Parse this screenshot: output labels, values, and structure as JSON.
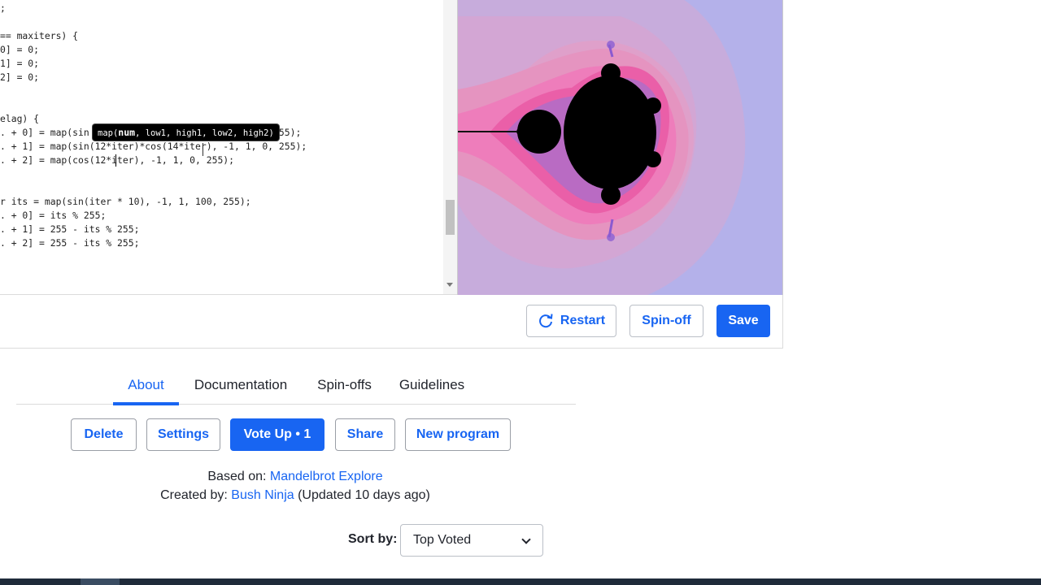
{
  "editor": {
    "lines": [
      ";",
      "== maxiters) {",
      "0] = 0;",
      "1] = 0;",
      "2] = 0;",
      "elag) {",
      ". + 0] = map(sin                              0, 255);",
      ". + 1] = map(sin(12*iter)*cos(14*iter), -1, 1, 0, 255);",
      ". + 2] = map(cos(12*iter), -1, 1, 0, 255);",
      "r its = map(sin(iter * 10), -1, 1, 100, 255);",
      ". + 0] = its % 255;",
      ". + 1] = 255 - its % 255;",
      ". + 2] = 255 - its % 255;"
    ],
    "tooltip": {
      "prefix": "map(",
      "param": "num",
      "rest": ", low1, high1, low2, high2)"
    }
  },
  "toolbar": {
    "restart": "Restart",
    "spinoff": "Spin-off",
    "save": "Save"
  },
  "tabs": {
    "about": "About",
    "documentation": "Documentation",
    "spinoffs": "Spin-offs",
    "guidelines": "Guidelines"
  },
  "actions": {
    "delete": "Delete",
    "settings": "Settings",
    "vote_up": "Vote Up • 1",
    "share": "Share",
    "new_program": "New program"
  },
  "meta": {
    "based_label": "Based on: ",
    "based_link": "Mandelbrot Explore",
    "created_label": "Created by: ",
    "created_link": "Bush Ninja",
    "updated": " (Updated 10 days ago)"
  },
  "sort": {
    "label": "Sort by:",
    "selected": "Top Voted"
  },
  "colors": {
    "accent": "#1865f2",
    "fractal_background": "#b7b3ea",
    "fractal_pink": "#ee7dbb"
  }
}
